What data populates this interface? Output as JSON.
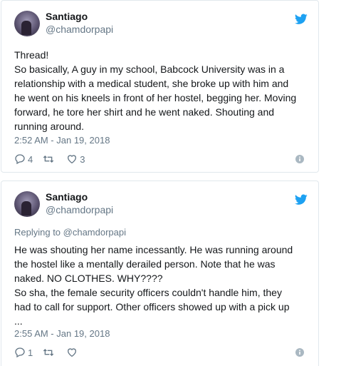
{
  "tweets": [
    {
      "name": "Santiago",
      "handle": "@chamdorpapi",
      "reply_to": "",
      "text_lines": [
        "Thread!",
        "So basically, A guy in my school, Babcock University was in a",
        "relationship with a medical student, she broke up with him and",
        "he went on his kneels in front of her hostel, begging her. Moving",
        "forward, he tore her shirt and he went naked. Shouting and",
        "running around."
      ],
      "timestamp": "2:52 AM - Jan 19, 2018",
      "reply_count": "4",
      "retweet_count": "",
      "like_count": "3"
    },
    {
      "name": "Santiago",
      "handle": "@chamdorpapi",
      "reply_to": "Replying to @chamdorpapi",
      "text_lines": [
        "He was shouting her name incessantly. He was running around",
        "the hostel like a mentally derailed person. Note that he was",
        "naked. NO CLOTHES. WHY????",
        "So sha, the female security officers couldn't handle him, they",
        "had to call for support. Other officers showed up with a pick up",
        "..."
      ],
      "timestamp": "2:55 AM - Jan 19, 2018",
      "reply_count": "1",
      "retweet_count": "",
      "like_count": ""
    }
  ],
  "colors": {
    "brand": "#1da1f2",
    "muted": "#657786",
    "text": "#14171a",
    "border": "#e1e8ed"
  },
  "icons": [
    "twitter-bird-icon",
    "reply-icon",
    "retweet-icon",
    "like-icon",
    "info-icon"
  ]
}
